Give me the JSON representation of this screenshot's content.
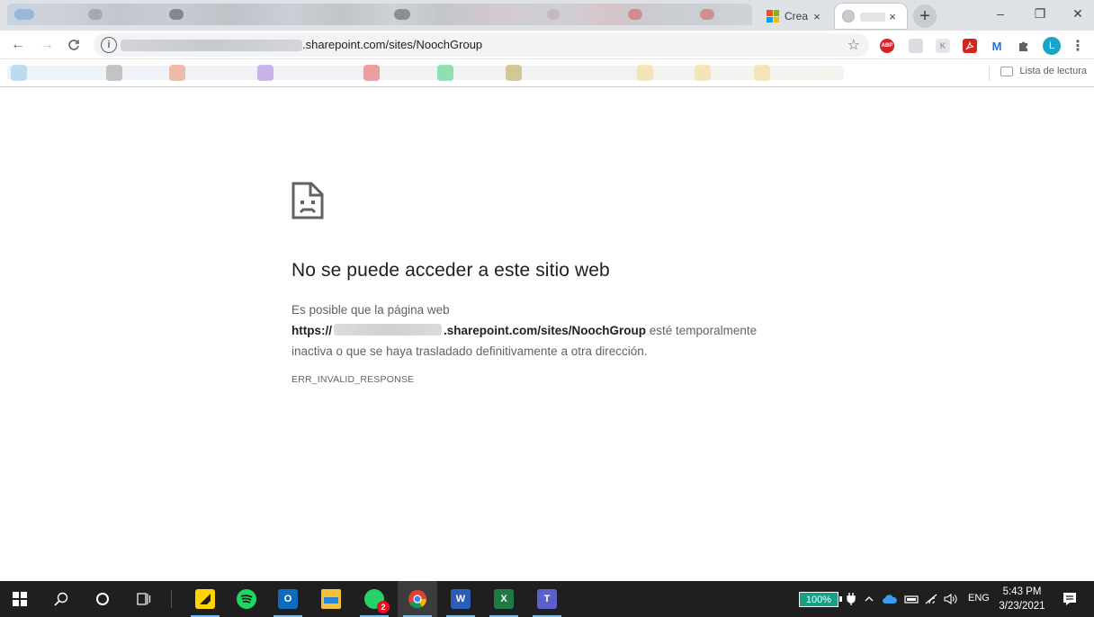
{
  "window": {
    "tabs": [
      {
        "title": "Crea",
        "favicon": "microsoft-logo",
        "close": "×",
        "state": "inactive"
      },
      {
        "title": "",
        "favicon": "globe-icon",
        "close": "×",
        "state": "active"
      }
    ],
    "new_tab": "+",
    "controls": {
      "minimize": "–",
      "restore": "❐",
      "close": "✕"
    }
  },
  "toolbar": {
    "back": "←",
    "forward": "→",
    "reload": "C",
    "address_visible": ".sharepoint.com/sites/NoochGroup",
    "star": "☆",
    "extensions": {
      "abp": "ABP",
      "k": "K",
      "m": "M",
      "avatar": "L",
      "menu": "⋮"
    }
  },
  "bookmarks": {
    "reading_list": "Lista de lectura"
  },
  "error_page": {
    "title": "No se puede acceder a este sitio web",
    "line1": "Es posible que la página web",
    "url_prefix": "https://",
    "url_suffix": ".sharepoint.com/sites/NoochGroup",
    "line2_after_url": " esté temporalmente",
    "line3": "inactiva o que se haya trasladado definitivamente a otra dirección.",
    "code": "ERR_INVALID_RESPONSE"
  },
  "taskbar": {
    "whatsapp_badge": "2",
    "word_letter": "W",
    "excel_letter": "X",
    "teams_letter": "T",
    "battery": "100%",
    "language": "ENG",
    "time": "5:43 PM",
    "date": "3/23/2021"
  },
  "colors": {
    "tabstrip": "#dee1e6",
    "accent_blue": "#1a73e8",
    "error_title": "#202124",
    "error_text": "#5f6368",
    "taskbar": "#1f1f1f",
    "battery": "#16a085"
  }
}
